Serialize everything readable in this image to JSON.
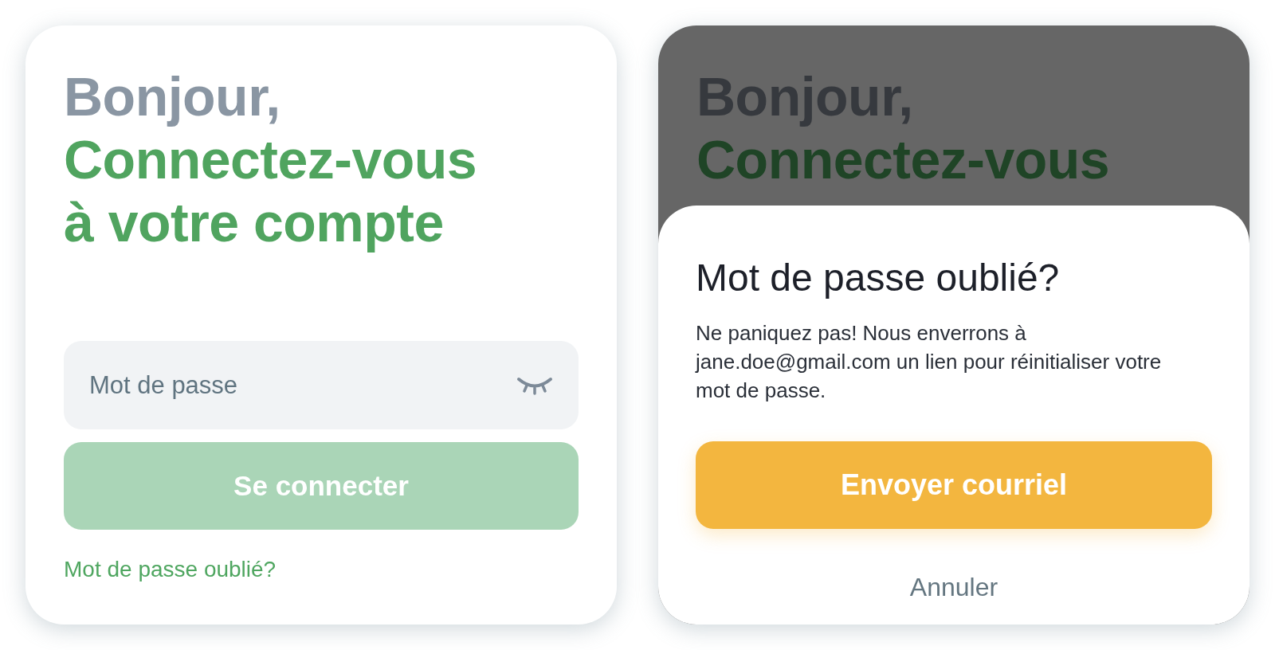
{
  "login_screen": {
    "greeting": "Bonjour,",
    "title_lines": [
      "Connectez-vous",
      "à votre compte"
    ],
    "password_field": {
      "placeholder": "Mot de passe",
      "password_visible": false
    },
    "login_button": {
      "label": "Se connecter",
      "disabled": true
    },
    "forgot_link": "Mot de passe oublié?"
  },
  "dimmed_screen": {
    "greeting": "Bonjour,",
    "title_lines": [
      "Connectez-vous"
    ]
  },
  "reset_sheet": {
    "title": "Mot de passe oublié?",
    "message": "Ne paniquez pas! Nous enverrons à\njane.doe@gmail.com un lien pour réinitialiser votre\nmot de passe.",
    "send_button": "Envoyer courriel",
    "cancel_button": "Annuler"
  }
}
